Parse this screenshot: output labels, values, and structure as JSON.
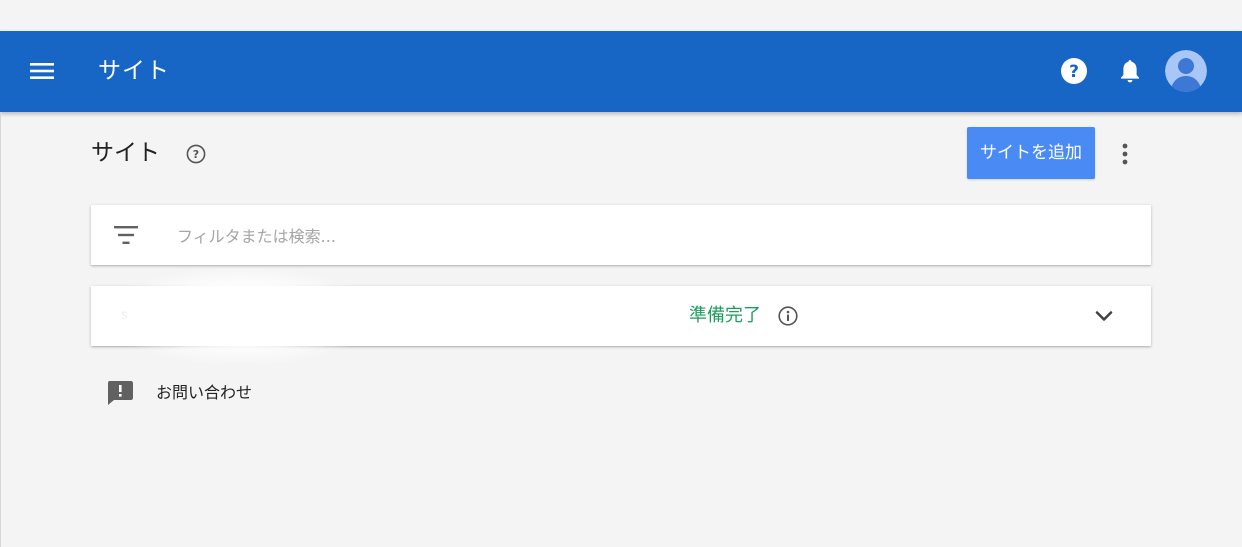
{
  "app_bar": {
    "title": "サイト",
    "menu_icon": "hamburger-menu-icon",
    "help_icon": "help-circle-icon",
    "notifications_icon": "bell-icon",
    "avatar_icon": "account-avatar-icon",
    "background_color": "#1766c5"
  },
  "page": {
    "title": "サイト",
    "help_icon": "help-outline-icon",
    "add_site_button": "サイトを追加",
    "add_site_button_color": "#4a8af4",
    "more_icon": "more-vert-icon"
  },
  "filter": {
    "placeholder": "フィルタまたは検索...",
    "value": "",
    "icon": "filter-list-icon"
  },
  "sites": [
    {
      "name": "s",
      "status": "準備完了",
      "status_color": "#1e9e5e",
      "info_icon": "info-outline-icon",
      "expand_icon": "chevron-down-icon"
    }
  ],
  "feedback": {
    "label": "お問い合わせ",
    "icon": "feedback-icon"
  }
}
